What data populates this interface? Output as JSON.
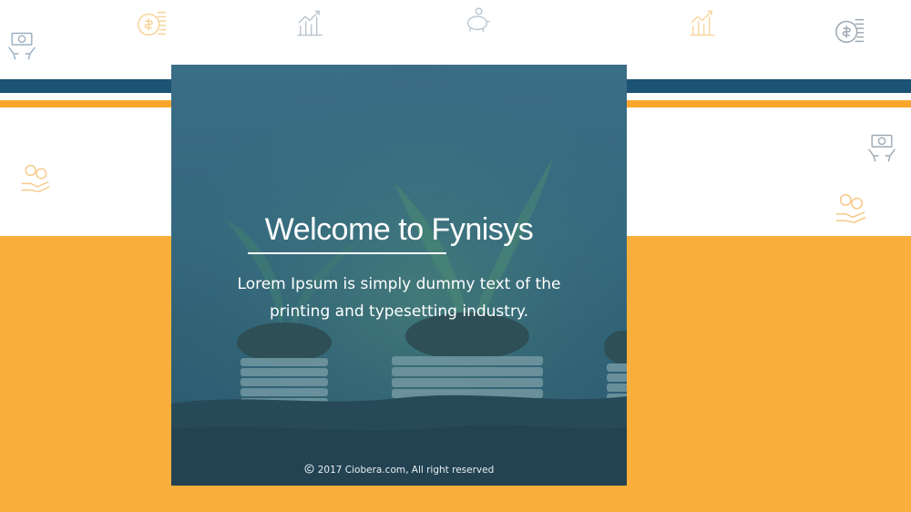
{
  "slide": {
    "title": "Welcome to Fynisys",
    "body": "Lorem Ipsum is simply dummy text of the printing and typesetting industry.",
    "footer": "2017 Ciobera.com, All right reserved"
  },
  "colors": {
    "navy": "#1c5274",
    "orange": "#f9a72c",
    "card_overlay": "#35697f"
  },
  "icons": [
    "money-hands-icon",
    "dollar-stack-icon",
    "growth-chart-icon",
    "piggy-bank-icon",
    "coins-hand-icon",
    "copyright-icon"
  ]
}
